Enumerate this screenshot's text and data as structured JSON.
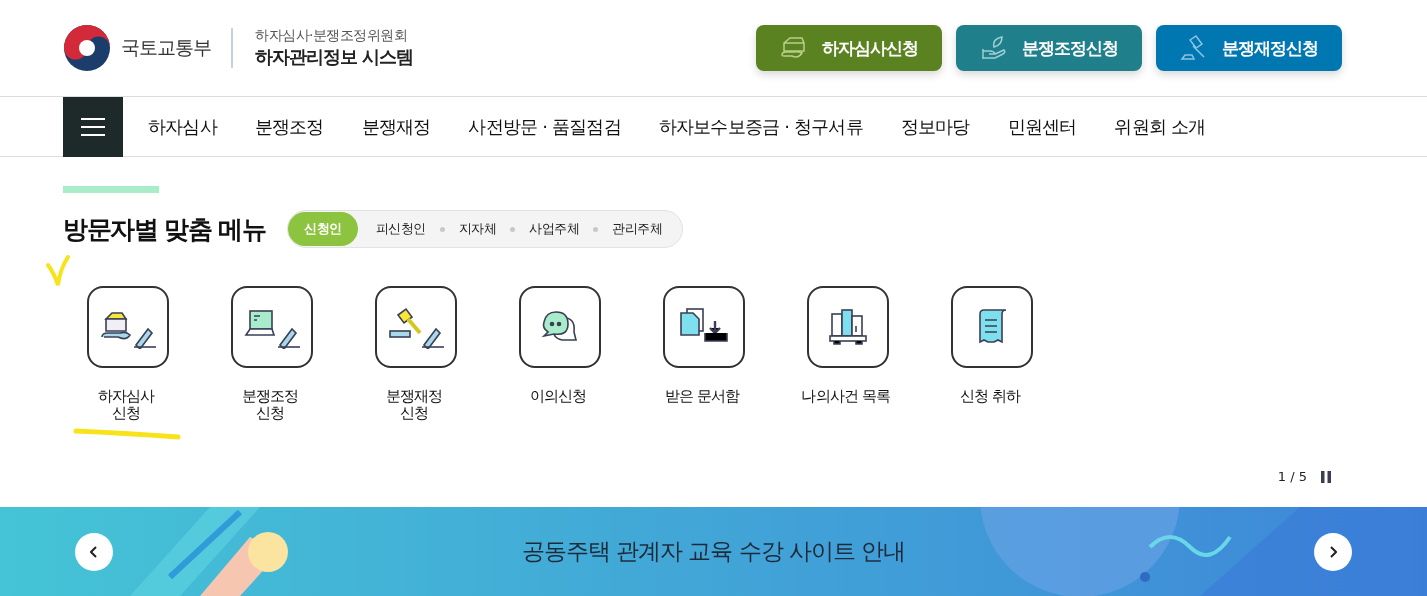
{
  "header": {
    "ministry": "국토교통부",
    "subtitle": "하자심사·분쟁조정위원회",
    "system_name": "하자관리정보 시스템",
    "buttons": [
      {
        "label": "하자심사신청",
        "kind": "house"
      },
      {
        "label": "분쟁조정신청",
        "kind": "hand"
      },
      {
        "label": "분쟁재정신청",
        "kind": "gavel"
      }
    ]
  },
  "nav": {
    "items": [
      "하자심사",
      "분쟁조정",
      "분쟁재정",
      "사전방문 · 품질점검",
      "하자보수보증금 · 청구서류",
      "정보마당",
      "민원센터",
      "위원회 소개"
    ]
  },
  "visitor_menu": {
    "title": "방문자별 맞춤 메뉴",
    "tabs": [
      {
        "label": "신청인",
        "selected": true
      },
      {
        "label": "피신청인",
        "selected": false
      },
      {
        "label": "지자체",
        "selected": false
      },
      {
        "label": "사업주체",
        "selected": false
      },
      {
        "label": "관리주체",
        "selected": false
      }
    ],
    "tiles": [
      {
        "label": "하자심사\n신청",
        "kind": "house"
      },
      {
        "label": "분쟁조정\n신청",
        "kind": "laptop"
      },
      {
        "label": "분쟁재정\n신청",
        "kind": "gavel"
      },
      {
        "label": "이의신청",
        "kind": "chat"
      },
      {
        "label": "받은 문서함",
        "kind": "inbox"
      },
      {
        "label": "나의사건 목록",
        "kind": "books"
      },
      {
        "label": "신청 취하",
        "kind": "receipt"
      }
    ],
    "pager": "1 / 5"
  },
  "banner": {
    "title": "공동주택 관계자 교육 수강 사이트 안내"
  }
}
